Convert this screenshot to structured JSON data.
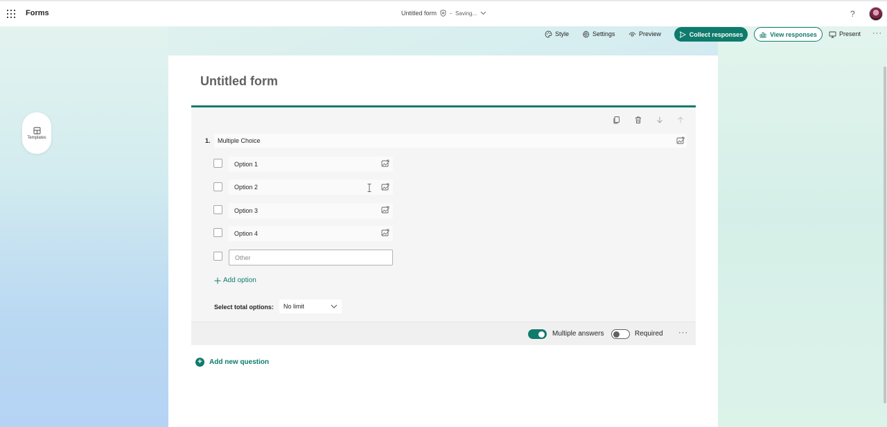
{
  "app": {
    "name": "Forms"
  },
  "document": {
    "title": "Untitled form",
    "separator": "-",
    "status": "Saving..."
  },
  "toolbar": {
    "style_label": "Style",
    "settings_label": "Settings",
    "preview_label": "Preview",
    "collect_label": "Collect responses",
    "view_label": "View responses",
    "present_label": "Present"
  },
  "sidebar": {
    "templates_label": "Templates"
  },
  "form": {
    "title": "Untitled form",
    "question": {
      "number": "1.",
      "text": "Multiple Choice",
      "options": [
        "Option 1",
        "Option 2",
        "Option 3",
        "Option 4"
      ],
      "other_placeholder": "Other",
      "add_option_label": "Add option",
      "select_total_label": "Select total options:",
      "select_total_value": "No limit",
      "multiple_answers_label": "Multiple answers",
      "multiple_answers_on": true,
      "required_label": "Required",
      "required_on": false
    },
    "add_question_label": "Add new question"
  },
  "colors": {
    "accent": "#0f7b6c"
  }
}
